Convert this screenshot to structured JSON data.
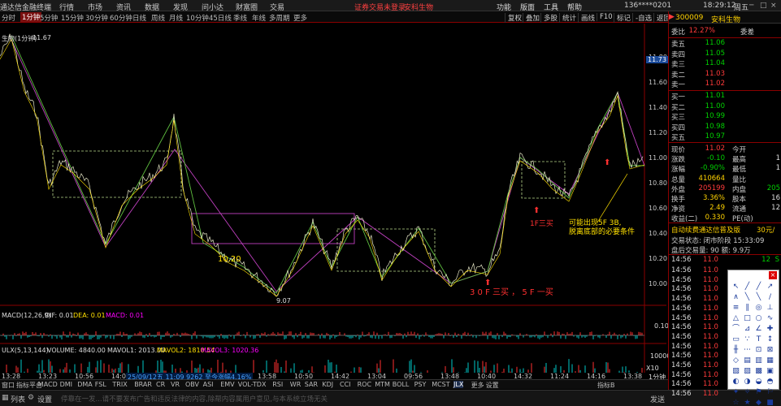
{
  "topbar": {
    "app_title": "通达信金融终端",
    "menus": [
      "行情",
      "市场",
      "资讯",
      "数据",
      "发现",
      "问小达",
      "财富圈",
      "交易"
    ],
    "warning": "证券交易未登录",
    "stock": "安科生物",
    "right_menus": [
      "功能",
      "版面",
      "工具",
      "帮助"
    ],
    "account": "136****0201",
    "clock": "18:29:12",
    "weekday": "周五"
  },
  "periods": {
    "items": [
      "分时",
      "1分钟",
      "5分钟",
      "15分钟",
      "30分钟",
      "60分钟",
      "日线",
      "周线",
      "月线",
      "10分钟",
      "45日线",
      "季线",
      "年线",
      "多周期",
      "更多"
    ],
    "active": "1分钟",
    "tools": [
      "复权",
      "叠加",
      "多股",
      "统计",
      "画线",
      "F10",
      "标记",
      "-自选",
      "返回"
    ]
  },
  "chart": {
    "title": "生物(1分钟)",
    "high_label": "11.67",
    "low_label": "9.07",
    "right_price_badge": "11.73",
    "mark_1020": "10.20",
    "annotation_1": "3 0 F 三买 ， 5 F 一买",
    "annotation_2": "1F三买",
    "annotation_3_line1": "可能出现5F 3B,",
    "annotation_3_line2": "脱离底部的必要条件",
    "right_axis": [
      "11.80",
      "11.60",
      "11.40",
      "11.20",
      "11.00",
      "10.80",
      "10.60",
      "10.40",
      "10.20",
      "10.00"
    ],
    "macd_label": "MACD(12,26,9)",
    "dif": "DIF: 0.01",
    "dea": "DEA: 0.01",
    "macd": "MACD: 0.01",
    "macd_axis": "0.10",
    "vol_label": "ULX(5,13,144)",
    "volume": "VOLUME: 4840.00",
    "mavol1": "MAVOL1: 2013.00",
    "mavol2": "MAVOL2: 1810.54",
    "mavol3": "MAVOL3: 1020.36",
    "vol_axis": "10000",
    "time_labels": [
      "13:28",
      "13:23",
      "10:56",
      "14:07",
      "13:55",
      "10:40",
      "13:14",
      "13:58",
      "10:50",
      "14:42",
      "13:04",
      "09:56",
      "13:48",
      "10:40",
      "14:32",
      "11:24",
      "14:16",
      "13:38"
    ],
    "time_info": "25/09/12五 11:09 9262 至今涨幅4.16%",
    "period_tag": "1分钟",
    "x10_tag": "X10"
  },
  "chart_data": {
    "type": "line",
    "x_unit": "1-minute bars",
    "y_range": [
      10.0,
      11.8
    ],
    "notable_points": [
      {
        "label": "high",
        "value": 11.67
      },
      {
        "label": "low",
        "value": 9.07
      }
    ]
  },
  "bottombar": {
    "items": [
      "窗口",
      "指标平台",
      "MACD",
      "DMI",
      "DMA",
      "FSL",
      "TRIX",
      "BRAR",
      "CR",
      "VR",
      "OBV",
      "ASI",
      "EMV",
      "VOL-TDX",
      "RSI",
      "WR",
      "SAR",
      "KDJ",
      "CCI",
      "ROC",
      "MTM",
      "BOLL",
      "PSY",
      "MCST",
      "JLX",
      "更多",
      "设置"
    ],
    "active": "JLX",
    "right": "指标B"
  },
  "statusbar": {
    "list_btn": "列表",
    "settings_btn": "设置",
    "ticker": "停靠在一发...请不要发布广告和违反法律的内容,除帮内容属用户意见,与本系统立场无关",
    "send_btn": "发送"
  },
  "panel": {
    "code": "300009",
    "name": "安科生物",
    "webi": "12.27%",
    "weicha": "委差",
    "asks": [
      {
        "label": "卖五",
        "price": "11.06",
        "qty": ""
      },
      {
        "label": "卖四",
        "price": "11.05",
        "qty": ""
      },
      {
        "label": "卖三",
        "price": "11.04",
        "qty": ""
      },
      {
        "label": "卖二",
        "price": "11.03",
        "qty": ""
      },
      {
        "label": "卖一",
        "price": "11.02",
        "qty": ""
      }
    ],
    "bids": [
      {
        "label": "买一",
        "price": "11.01",
        "qty": ""
      },
      {
        "label": "买二",
        "price": "11.00",
        "qty": ""
      },
      {
        "label": "买三",
        "price": "10.99",
        "qty": ""
      },
      {
        "label": "买四",
        "price": "10.98",
        "qty": ""
      },
      {
        "label": "买五",
        "price": "10.97",
        "qty": ""
      }
    ],
    "stats": [
      {
        "l1": "现价",
        "v1": "11.02",
        "l2": "今开",
        "v2": ""
      },
      {
        "l1": "涨跌",
        "v1": "-0.10",
        "l2": "最高",
        "v2": "1"
      },
      {
        "l1": "涨幅",
        "v1": "-0.90%",
        "l2": "最低",
        "v2": "1"
      },
      {
        "l1": "总量",
        "v1": "410664",
        "l2": "量比",
        "v2": ""
      },
      {
        "l1": "外盘",
        "v1": "205199",
        "l2": "内盘",
        "v2": "205"
      },
      {
        "l1": "换手",
        "v1": "3.36%",
        "l2": "股本",
        "v2": "16"
      },
      {
        "l1": "净资",
        "v1": "2.49",
        "l2": "流通",
        "v2": "12"
      },
      {
        "l1": "收益(二)",
        "v1": "0.330",
        "l2": "PE(动)",
        "v2": ""
      }
    ],
    "ad_line": "自动续费通达信普及版",
    "ad_price": "30元/",
    "trade_status": "交易状态: 闭市阶段 15:33:09",
    "after_hours": "盘后交易量: 90  额: 9.9万",
    "first_tick": {
      "time": "14:56",
      "price": "11.0",
      "qty": "12",
      "flag": "S"
    },
    "ticks": [
      {
        "time": "14:56",
        "price": "11.0"
      },
      {
        "time": "14:56",
        "price": "11.0"
      },
      {
        "time": "14:56",
        "price": "11.0"
      },
      {
        "time": "14:56",
        "price": "11.0"
      },
      {
        "time": "14:56",
        "price": "11.0"
      },
      {
        "time": "14:56",
        "price": "11.0"
      },
      {
        "time": "14:56",
        "price": "11.0"
      },
      {
        "time": "14:56",
        "price": "11.0"
      },
      {
        "time": "14:56",
        "price": "11.0"
      },
      {
        "time": "14:56",
        "price": "11.0"
      },
      {
        "time": "14:56",
        "price": "11.0"
      },
      {
        "time": "14:56",
        "price": "11.0"
      },
      {
        "time": "14:56",
        "price": "11.0"
      },
      {
        "time": "14:56",
        "price": "11.0"
      }
    ]
  },
  "toolbox": {
    "close": "×",
    "cells": [
      "↖",
      "╱",
      "╱",
      "↗",
      "∧",
      "╲",
      "╲",
      "/",
      "≡",
      "∥",
      "◎",
      "⊥",
      "△",
      "□",
      "○",
      "∿",
      "⌒",
      "⊿",
      "∠",
      "✚",
      "▭",
      "∵",
      "T",
      "↕",
      "╫",
      "⋯",
      "⊡",
      "⊠",
      "◇",
      "▤",
      "▥",
      "▦",
      "▧",
      "▨",
      "▩",
      "▣",
      "◐",
      "◑",
      "◒",
      "◓",
      "✦",
      "✧",
      "⚑",
      "⚐",
      "☆",
      "★",
      "◆",
      "■"
    ]
  }
}
